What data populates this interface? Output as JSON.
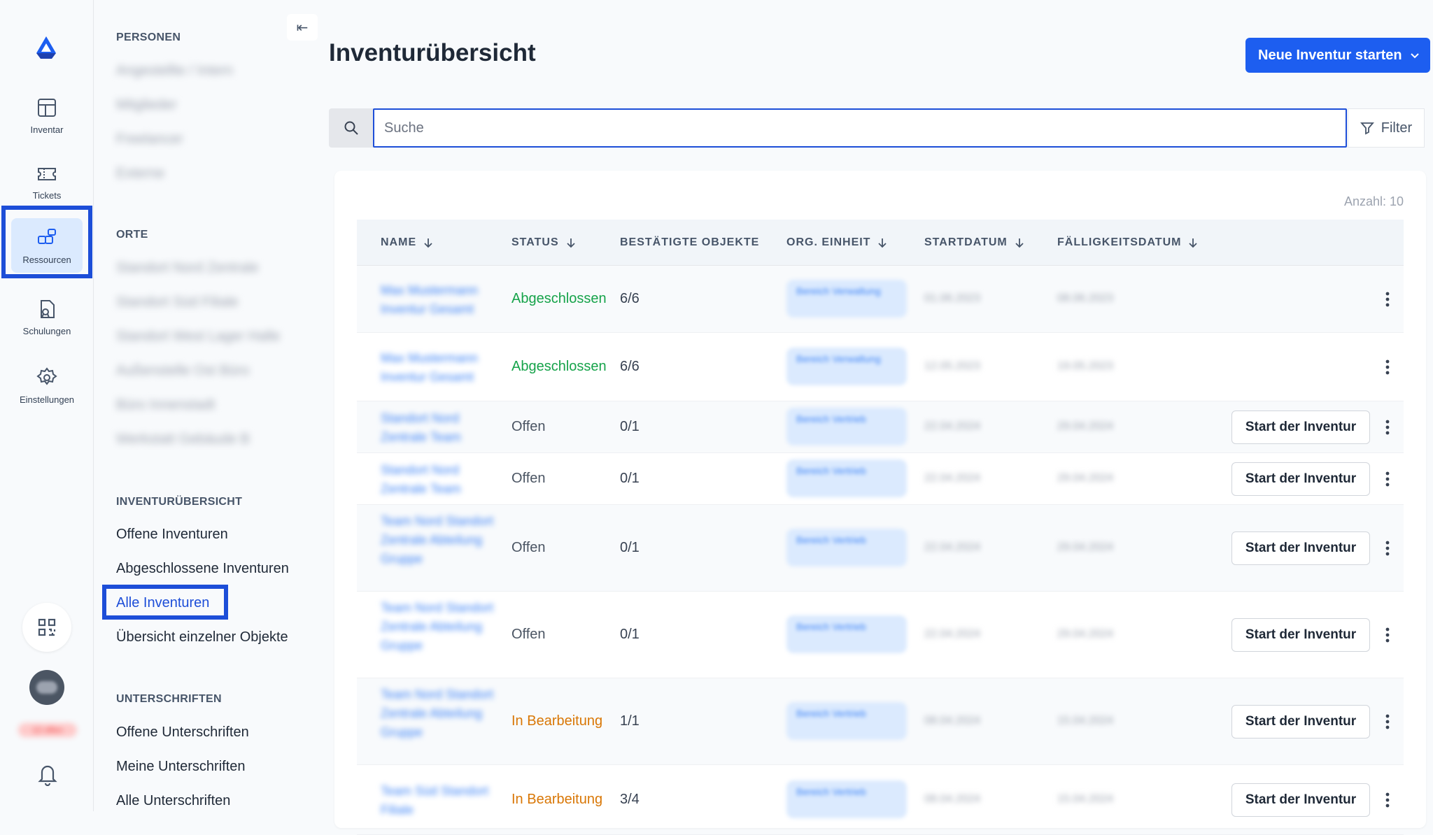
{
  "rail": {
    "items": [
      {
        "label": "Inventar",
        "icon": "grid-icon"
      },
      {
        "label": "Tickets",
        "icon": "ticket-icon"
      },
      {
        "label": "Ressourcen",
        "icon": "resources-icon"
      },
      {
        "label": "Schulungen",
        "icon": "training-icon"
      },
      {
        "label": "Einstellungen",
        "icon": "gear-icon"
      }
    ],
    "active": "Ressourcen",
    "badge_text": "12 offen"
  },
  "subnav": {
    "sections": {
      "personen": "PERSONEN",
      "orte": "ORTE",
      "inventur": "INVENTURÜBERSICHT",
      "unterschriften": "UNTERSCHRIFTEN"
    },
    "personen_links": [
      "Angestellte / Intern",
      "Mitglieder",
      "Freelancer",
      "Externe"
    ],
    "orte_links": [
      "Standort Nord Zentrale",
      "Standort Süd Filiale",
      "Standort West Lager Halle",
      "Außenstelle Ost Büro",
      "Büro Innenstadt",
      "Werkstatt Gebäude B"
    ],
    "inventur_links": {
      "offene": "Offene Inventuren",
      "abgeschlossene": "Abgeschlossene Inventuren",
      "alle": "Alle Inventuren",
      "einzelne": "Übersicht einzelner Objekte"
    },
    "unterschriften_links": {
      "offene": "Offene Unterschriften",
      "meine": "Meine Unterschriften",
      "alle": "Alle Unterschriften"
    }
  },
  "main": {
    "title": "Inventurübersicht",
    "new_button": "Neue Inventur starten",
    "search": {
      "placeholder": "Suche",
      "value": ""
    },
    "filter_label": "Filter",
    "count_label": "Anzahl: 10",
    "columns": {
      "name": "NAME",
      "status": "STATUS",
      "confirmed": "BESTÄTIGTE OBJEKTE",
      "org": "ORG. EINHEIT",
      "start": "STARTDATUM",
      "due": "FÄLLIGKEITSDATUM"
    },
    "start_button": "Start der Inventur",
    "rows": [
      {
        "name": "Max Mustermann Inventur Gesamt",
        "status": "Abgeschlossen",
        "confirmed": "6/6",
        "org": "Bereich Verwaltung",
        "start": "01.06.2023",
        "due": "08.06.2023"
      },
      {
        "name": "Max Mustermann Inventur Gesamt",
        "status": "Abgeschlossen",
        "confirmed": "6/6",
        "org": "Bereich Verwaltung",
        "start": "12.05.2023",
        "due": "19.05.2023"
      },
      {
        "name": "Standort Nord Zentrale Team",
        "status": "Offen",
        "confirmed": "0/1",
        "org": "Bereich Vertrieb",
        "start": "22.04.2024",
        "due": "29.04.2024"
      },
      {
        "name": "Standort Nord Zentrale Team",
        "status": "Offen",
        "confirmed": "0/1",
        "org": "Bereich Vertrieb",
        "start": "22.04.2024",
        "due": "29.04.2024"
      },
      {
        "name": "Team Nord Standort Zentrale Abteilung Gruppe",
        "status": "Offen",
        "confirmed": "0/1",
        "org": "Bereich Vertrieb",
        "start": "22.04.2024",
        "due": "29.04.2024"
      },
      {
        "name": "Team Nord Standort Zentrale Abteilung Gruppe",
        "status": "Offen",
        "confirmed": "0/1",
        "org": "Bereich Vertrieb",
        "start": "22.04.2024",
        "due": "29.04.2024"
      },
      {
        "name": "Team Nord Standort Zentrale Abteilung Gruppe",
        "status": "In Bearbeitung",
        "confirmed": "1/1",
        "org": "Bereich Vertrieb",
        "start": "08.04.2024",
        "due": "15.04.2024"
      },
      {
        "name": "Team Süd Standort Filiale",
        "status": "In Bearbeitung",
        "confirmed": "3/4",
        "org": "Bereich Vertrieb",
        "start": "08.04.2024",
        "due": "15.04.2024"
      }
    ]
  },
  "colors": {
    "accent": "#1d5ef0",
    "highlight": "#1d4ed8",
    "status_done": "#16a34a",
    "status_progress": "#d97706"
  }
}
